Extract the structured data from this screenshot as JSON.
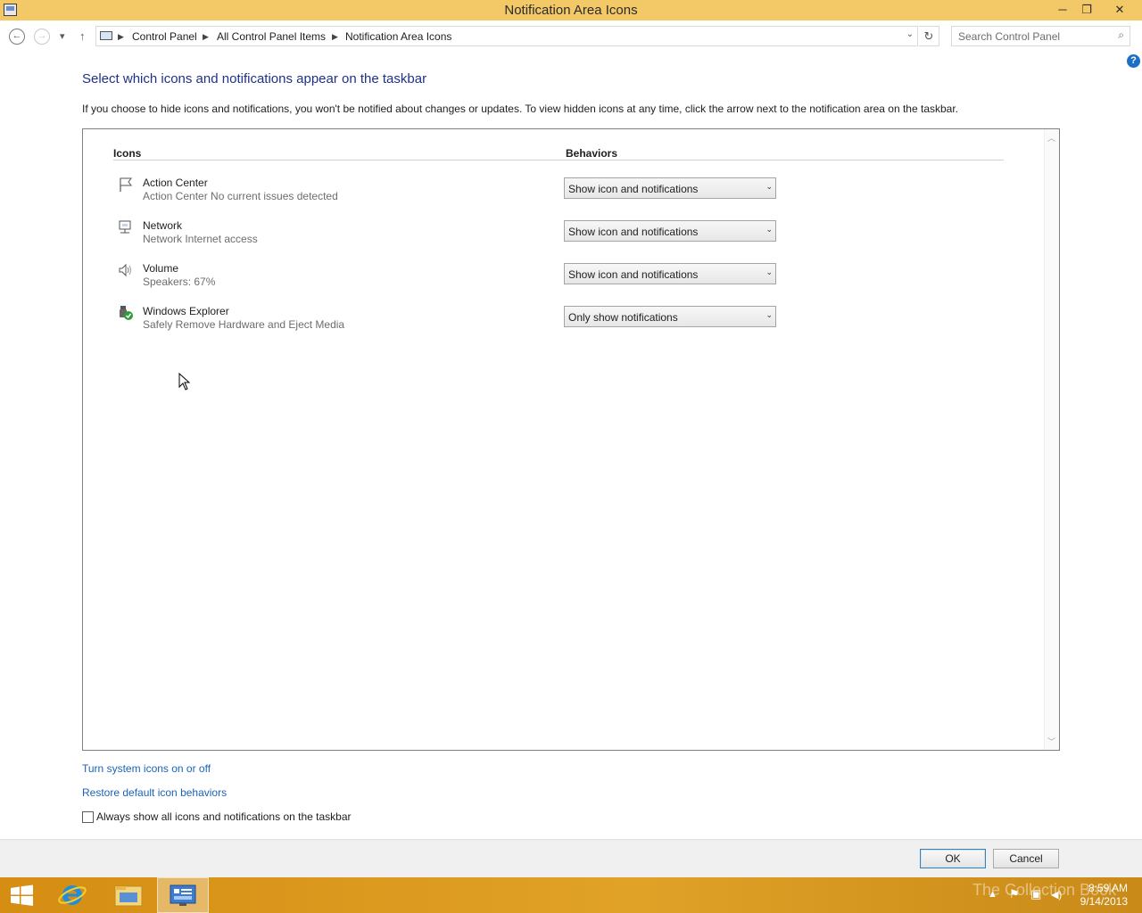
{
  "window": {
    "title": "Notification Area Icons",
    "minimize": "─",
    "restore": "❐",
    "close": "✕"
  },
  "addressbar": {
    "back_glyph": "←",
    "forward_glyph": "→",
    "recent_glyph": "▾",
    "up_glyph": "↑",
    "breadcrumbs": [
      "Control Panel",
      "All Control Panel Items",
      "Notification Area Icons"
    ],
    "separator": "▶",
    "dropdown_glyph": "⌄",
    "refresh_glyph": "↻",
    "search_placeholder": "Search Control Panel",
    "search_glyph": "⌕"
  },
  "help_glyph": "?",
  "main": {
    "heading": "Select which icons and notifications appear on the taskbar",
    "description": "If you choose to hide icons and notifications, you won't be notified about changes or updates. To view hidden icons at any time, click the arrow next to the notification area on the taskbar.",
    "columns": {
      "icons": "Icons",
      "behaviors": "Behaviors"
    },
    "rows": [
      {
        "name": "Action Center",
        "detail": "Action Center  No current issues detected",
        "behavior": "Show icon and notifications",
        "icon": "flag-icon"
      },
      {
        "name": "Network",
        "detail": "Network Internet access",
        "behavior": "Show icon and notifications",
        "icon": "network-icon"
      },
      {
        "name": "Volume",
        "detail": "Speakers: 67%",
        "behavior": "Show icon and notifications",
        "icon": "speaker-icon"
      },
      {
        "name": "Windows Explorer",
        "detail": "Safely Remove Hardware and Eject Media",
        "behavior": "Only show notifications",
        "icon": "usb-eject-icon"
      }
    ],
    "dropdown_glyph": "⌄",
    "scroll_up_glyph": "︿",
    "scroll_down_glyph": "﹀"
  },
  "links": {
    "system_icons": "Turn system icons on or off",
    "restore_defaults": "Restore default icon behaviors"
  },
  "always_show": {
    "label": "Always show all icons and notifications on the taskbar",
    "checked": false
  },
  "buttons": {
    "ok": "OK",
    "cancel": "Cancel"
  },
  "taskbar": {
    "time": "8:59 AM",
    "date": "9/14/2013",
    "tray_glyphs": {
      "overflow": "▲",
      "flag": "⚑",
      "network": "▣",
      "volume": "◀)"
    },
    "watermark": "The Collection Book"
  },
  "colors": {
    "titlebar": "#f3c967",
    "taskbar": "#e0a227",
    "heading": "#1e3287",
    "link": "#1b63b8"
  }
}
